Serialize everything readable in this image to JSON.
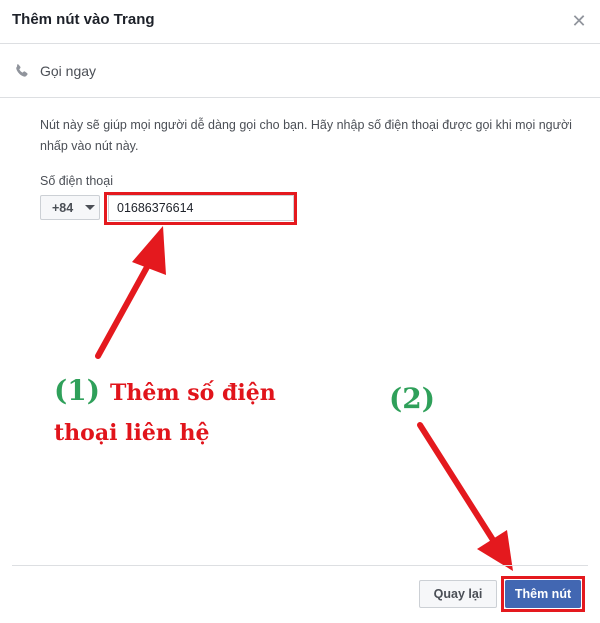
{
  "dialog": {
    "title": "Thêm nút vào Trang",
    "close_icon": "close-icon"
  },
  "section": {
    "icon": "phone-icon",
    "title": "Gọi ngay"
  },
  "description": "Nút này sẽ giúp mọi người dễ dàng gọi cho bạn. Hãy nhập số điện thoại được gọi khi mọi người nhấp vào nút này.",
  "phone": {
    "label": "Số điện thoại",
    "country_code": "+84",
    "value": "01686376614"
  },
  "annotations": {
    "step1_number": "(1)",
    "step1_text_line1": "Thêm số điện",
    "step1_text_line2": "thoại liên hệ",
    "step2_number": "(2)",
    "color_number": "#2fa05a",
    "color_text": "#e1141b"
  },
  "footer": {
    "back_label": "Quay lại",
    "add_label": "Thêm nút"
  },
  "colors": {
    "primary_button": "#4267b2",
    "highlight_border": "#e4191e"
  }
}
